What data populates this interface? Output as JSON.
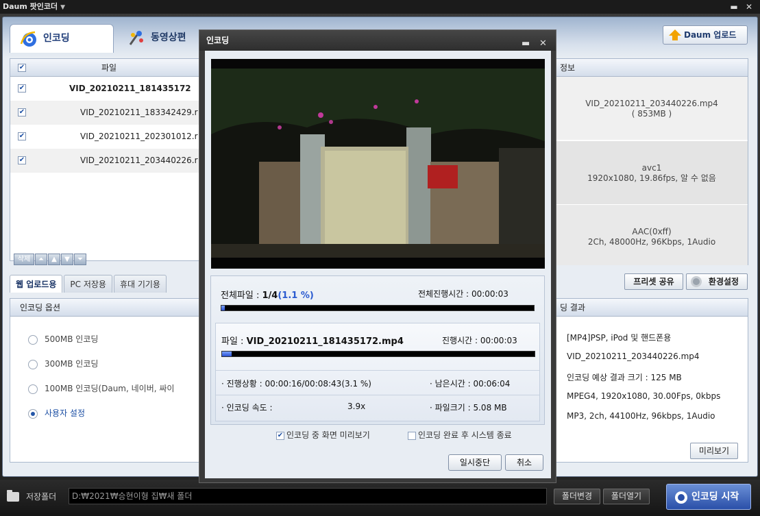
{
  "app": {
    "title": "Daum 팟인코더"
  },
  "tabs": {
    "encoding": "인코딩",
    "video_edit": "동영상편"
  },
  "upload_button": "Daum 업로드",
  "file_list": {
    "header": "파일",
    "items": [
      {
        "name": "VID_20210211_181435172",
        "checked": true
      },
      {
        "name": "VID_20210211_183342429.r",
        "checked": true
      },
      {
        "name": "VID_20210211_202301012.r",
        "checked": true
      },
      {
        "name": "VID_20210211_203440226.r",
        "checked": true
      }
    ],
    "delete_label": "삭제"
  },
  "sub_tabs": [
    "웹 업로드용",
    "PC 저장용",
    "휴대 기기용"
  ],
  "encoding_options": {
    "header": "인코딩 옵션",
    "items": [
      {
        "label": "500MB 인코딩",
        "selected": false
      },
      {
        "label": "300MB 인코딩",
        "selected": false
      },
      {
        "label": "100MB 인코딩(Daum, 네이버, 싸이",
        "selected": false
      },
      {
        "label": "사용자 설정",
        "selected": true
      }
    ]
  },
  "info": {
    "header": "정보",
    "file": "VID_20210211_203440226.mp4",
    "size": "( 853MB )",
    "video_codec": "avc1",
    "video_detail": "1920x1080, 19.86fps, 알 수 없음",
    "audio_codec": "AAC(0xff)",
    "audio_detail": "2Ch, 48000Hz, 96Kbps, 1Audio"
  },
  "preset_share": "프리셋 공유",
  "settings": "환경설정",
  "result": {
    "header": "딩 결과",
    "lines": [
      "[MP4]PSP, iPod 및 핸드폰용",
      "VID_20210211_203440226.mp4",
      "인코딩 예상 결과 크기 : 125 MB",
      "MPEG4, 1920x1080, 30.00Fps, 0kbps",
      "MP3, 2ch, 44100Hz, 96kbps, 1Audio"
    ],
    "preview_button": "미리보기"
  },
  "bottom": {
    "save_folder_label": "저장폴더",
    "path": "D:₩2021₩승현이형 집₩새 폴더",
    "change_folder": "폴더변경",
    "open_folder": "폴더열기",
    "start": "인코딩 시작"
  },
  "dialog": {
    "title": "인코딩",
    "total_files_label": "전체파일 :",
    "total_files_value": "1/4",
    "total_percent": "(1.1 %)",
    "total_progress_fraction": 0.011,
    "total_time_label": "전체진행시간 :",
    "total_time": "00:00:03",
    "file_label": "파일 :",
    "file_name": "VID_20210211_181435172.mp4",
    "file_time_label": "진행시간 :",
    "file_time": "00:00:03",
    "file_progress_fraction": 0.031,
    "status_label": "· 진행상황 :",
    "status_value": "00:00:16/00:08:43(3.1 %)",
    "remaining_label": "· 남은시간 :",
    "remaining_value": "00:06:04",
    "speed_label": "· 인코딩 속도 :",
    "speed_value": "3.9x",
    "filesize_label": "· 파일크기 :",
    "filesize_value": "5.08 MB",
    "preview_checkbox": "인코딩 중 화면 미리보기",
    "shutdown_checkbox": "인코딩 완료 후 시스템 종료",
    "pause_button": "일시중단",
    "cancel_button": "취소"
  }
}
